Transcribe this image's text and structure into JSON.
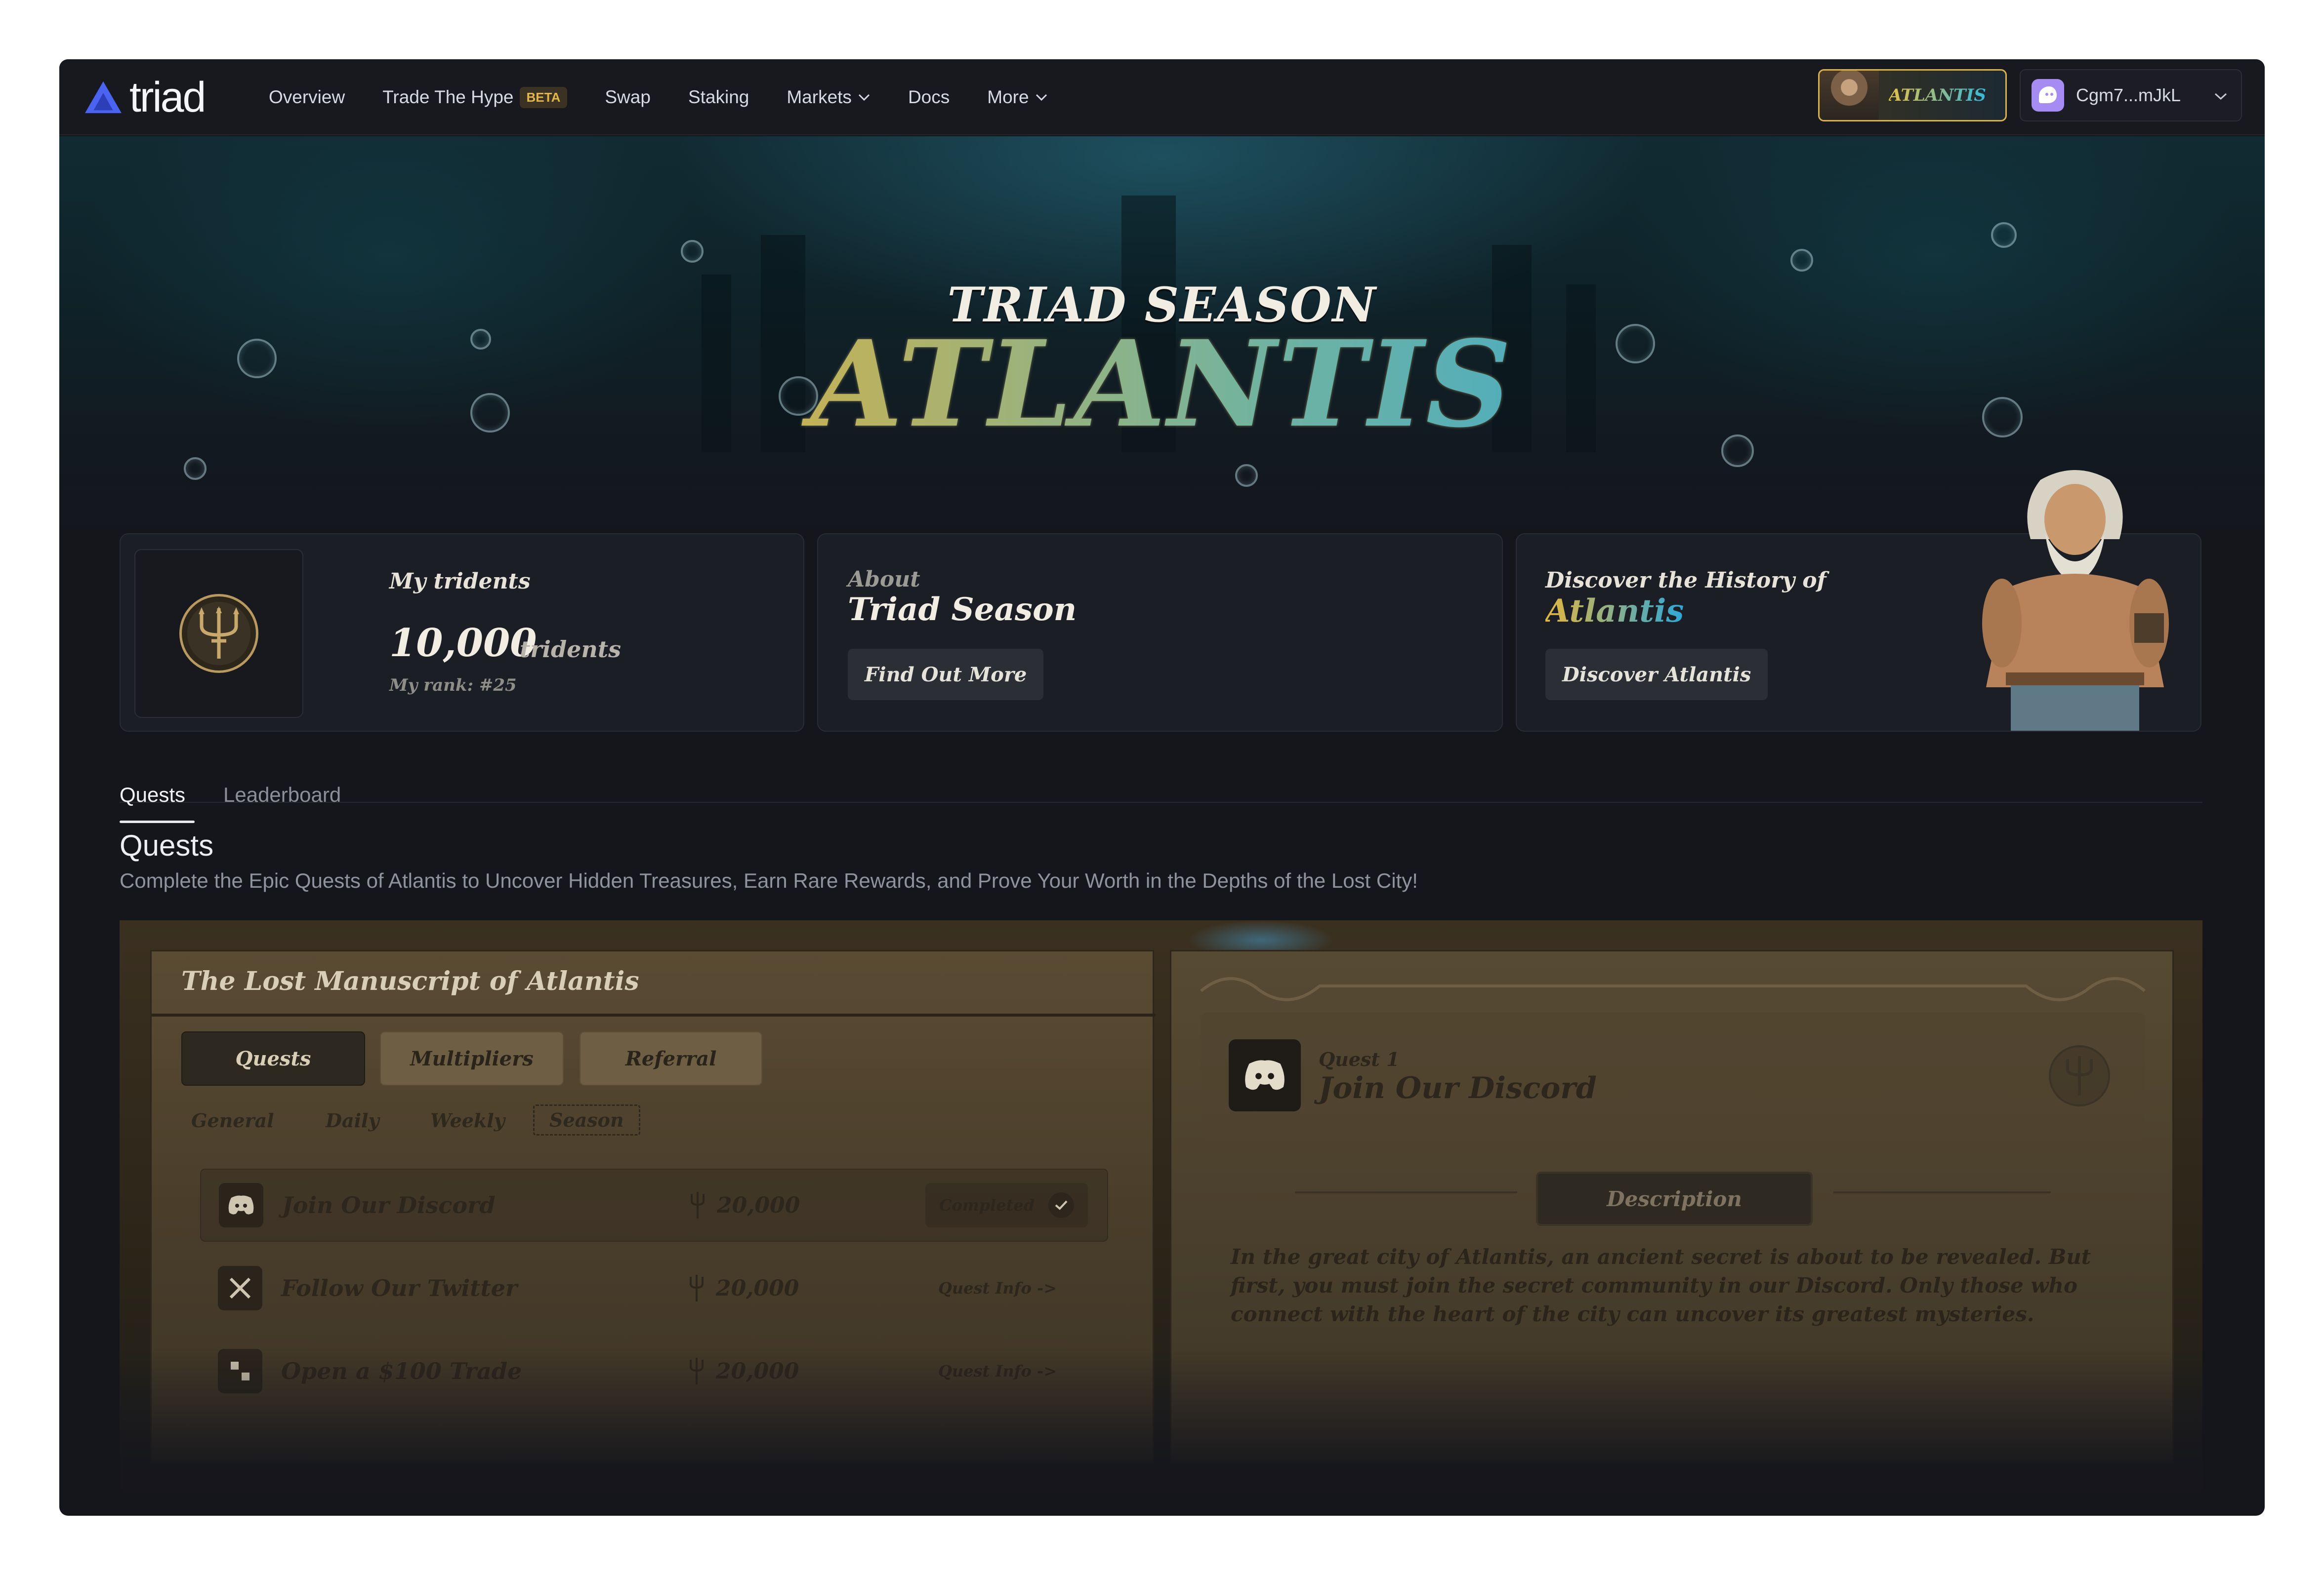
{
  "nav": {
    "logo_text": "triad",
    "links": [
      "Overview",
      "Trade The Hype",
      "Swap",
      "Staking",
      "Markets",
      "Docs",
      "More"
    ],
    "beta_badge": "BETA",
    "season_button": "ATLANTIS",
    "wallet_address": "Cgm7...mJkL"
  },
  "hero": {
    "subtitle": "TRIAD SEASON",
    "title": "ATLANTIS"
  },
  "cards": {
    "tridents": {
      "label": "My tridents",
      "amount": "10,000",
      "unit": "tridents",
      "rank": "My rank: #25"
    },
    "about": {
      "label": "About",
      "title": "Triad Season",
      "button": "Find Out More"
    },
    "discover": {
      "label": "Discover the History of",
      "title": "Atlantis",
      "button": "Discover Atlantis"
    }
  },
  "tabs": {
    "quests": "Quests",
    "leaderboard": "Leaderboard"
  },
  "quests_section": {
    "title": "Quests",
    "description": "Complete the Epic Quests of Atlantis to Uncover Hidden Treasures, Earn Rare Rewards, and Prove Your Worth in the Depths of the Lost City!"
  },
  "manuscript": {
    "title": "The Lost Manuscript of Atlantis",
    "primary_tabs": [
      "Quests",
      "Multipliers",
      "Referral"
    ],
    "sub_tabs": [
      "General",
      "Daily",
      "Weekly",
      "Season"
    ],
    "rows": [
      {
        "name": "Join Our Discord",
        "points": "20,000",
        "status": "Completed"
      },
      {
        "name": "Follow Our Twitter",
        "points": "20,000",
        "status": "Quest Info ->"
      },
      {
        "name": "Open a $100 Trade",
        "points": "20,000",
        "status": "Quest Info ->"
      }
    ]
  },
  "quest_detail": {
    "number": "Quest 1",
    "title": "Join Our Discord",
    "tab": "Description",
    "text": "In the great city of Atlantis, an ancient secret is about to be revealed. But first, you must join the secret community in our Discord. Only those who connect with the heart of the city can uncover its greatest mysteries."
  },
  "colors": {
    "background": "#15161c",
    "accent_gold": "#e4b73e",
    "accent_cyan": "#2ea7d9",
    "beta": "#e3b449"
  }
}
